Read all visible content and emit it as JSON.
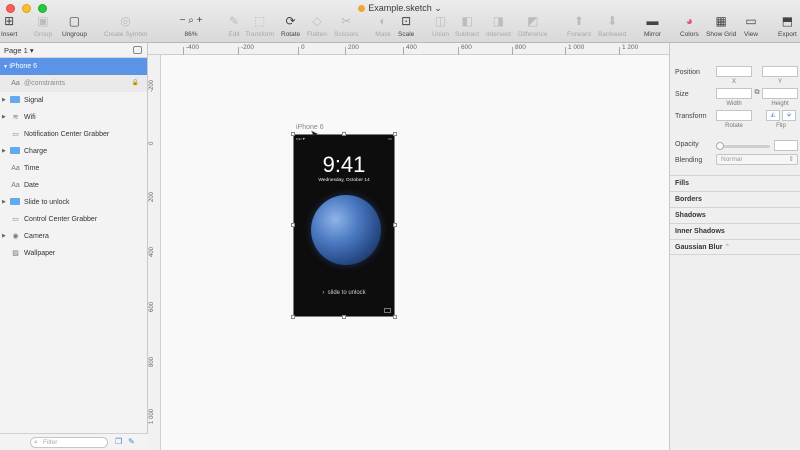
{
  "window": {
    "title": "Example.sketch"
  },
  "toolbar": {
    "items": [
      {
        "label": "Insert",
        "icon": "plus-icon",
        "enabled": true
      },
      {
        "label": "Group",
        "icon": "group-icon",
        "enabled": false
      },
      {
        "label": "Ungroup",
        "icon": "ungroup-icon",
        "enabled": true
      },
      {
        "label": "Create Symbol",
        "icon": "symbol-icon",
        "enabled": false
      },
      {
        "label": "86%",
        "icon": "zoom-icon",
        "enabled": true
      },
      {
        "label": "Edit",
        "icon": "edit-icon",
        "enabled": false
      },
      {
        "label": "Transform",
        "icon": "transform-icon",
        "enabled": false
      },
      {
        "label": "Rotate",
        "icon": "rotate-icon",
        "enabled": true
      },
      {
        "label": "Flatten",
        "icon": "flatten-icon",
        "enabled": false
      },
      {
        "label": "Scissors",
        "icon": "scissors-icon",
        "enabled": false
      },
      {
        "label": "Mask",
        "icon": "mask-icon",
        "enabled": false
      },
      {
        "label": "Scale",
        "icon": "scale-icon",
        "enabled": true
      },
      {
        "label": "Union",
        "icon": "union-icon",
        "enabled": false
      },
      {
        "label": "Subtract",
        "icon": "subtract-icon",
        "enabled": false
      },
      {
        "label": "Intersect",
        "icon": "intersect-icon",
        "enabled": false
      },
      {
        "label": "Difference",
        "icon": "difference-icon",
        "enabled": false
      },
      {
        "label": "Forward",
        "icon": "forward-icon",
        "enabled": false
      },
      {
        "label": "Backward",
        "icon": "backward-icon",
        "enabled": false
      },
      {
        "label": "Mirror",
        "icon": "mirror-icon",
        "enabled": true
      },
      {
        "label": "Colors",
        "icon": "colors-icon",
        "enabled": true
      },
      {
        "label": "Show Grid",
        "icon": "grid-icon",
        "enabled": true
      },
      {
        "label": "View",
        "icon": "view-icon",
        "enabled": true
      },
      {
        "label": "Export",
        "icon": "export-icon",
        "enabled": true
      }
    ]
  },
  "layers": {
    "page": "Page 1",
    "items": [
      {
        "name": "iPhone 6",
        "type": "artboard",
        "selected": true
      },
      {
        "name": "@constraints",
        "type": "text",
        "locked": true,
        "dim": true
      },
      {
        "name": "Signal",
        "type": "folder"
      },
      {
        "name": "Wifi",
        "type": "wifi"
      },
      {
        "name": "Notification Center Grabber",
        "type": "shape"
      },
      {
        "name": "Charge",
        "type": "folder"
      },
      {
        "name": "Time",
        "type": "text"
      },
      {
        "name": "Date",
        "type": "text"
      },
      {
        "name": "Slide to unlock",
        "type": "folder"
      },
      {
        "name": "Control Center Grabber",
        "type": "shape"
      },
      {
        "name": "Camera",
        "type": "camera"
      },
      {
        "name": "Wallpaper",
        "type": "image"
      }
    ],
    "filter_placeholder": "Filter"
  },
  "rulers": {
    "h": [
      "-400",
      "-200",
      "0",
      "200",
      "400",
      "600",
      "800",
      "1 000",
      "1 200"
    ],
    "v": [
      "-200",
      "0",
      "200",
      "400",
      "600",
      "800",
      "1 000"
    ]
  },
  "artboard": {
    "label": "iPhone 6",
    "time": "9:41",
    "date": "Wednesday, October 14",
    "unlock": "slide to unlock"
  },
  "inspector": {
    "position": "Position",
    "x": "X",
    "y": "Y",
    "size": "Size",
    "width": "Width",
    "height": "Height",
    "transform": "Transform",
    "rotate": "Rotate",
    "flip": "Flip",
    "opacity": "Opacity",
    "blending": "Blending",
    "blending_value": "Normal",
    "sections": [
      "Fills",
      "Borders",
      "Shadows",
      "Inner Shadows",
      "Gaussian Blur"
    ]
  }
}
